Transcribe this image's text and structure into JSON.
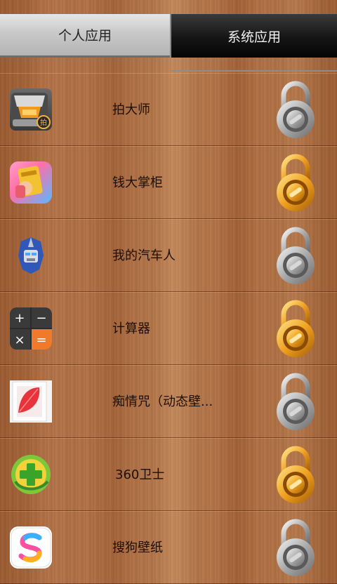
{
  "tabs": {
    "personal": "个人应用",
    "system": "系统应用"
  },
  "apps": [
    {
      "name": "拍大师",
      "icon": "camera-app-icon",
      "locked_color": "silver"
    },
    {
      "name": "钱大掌柜",
      "icon": "money-app-icon",
      "locked_color": "gold"
    },
    {
      "name": "我的汽车人",
      "icon": "robot-app-icon",
      "locked_color": "silver"
    },
    {
      "name": "计算器",
      "icon": "calculator-app-icon",
      "locked_color": "gold"
    },
    {
      "name": "痴情咒（动态壁...",
      "icon": "wallpaper-app-icon",
      "locked_color": "silver"
    },
    {
      "name": "360卫士",
      "icon": "security-app-icon",
      "locked_color": "gold"
    },
    {
      "name": "搜狗壁纸",
      "icon": "sogou-app-icon",
      "locked_color": "silver"
    }
  ],
  "colors": {
    "gold_lock": "#f0a020",
    "silver_lock": "#b8b8b8"
  }
}
